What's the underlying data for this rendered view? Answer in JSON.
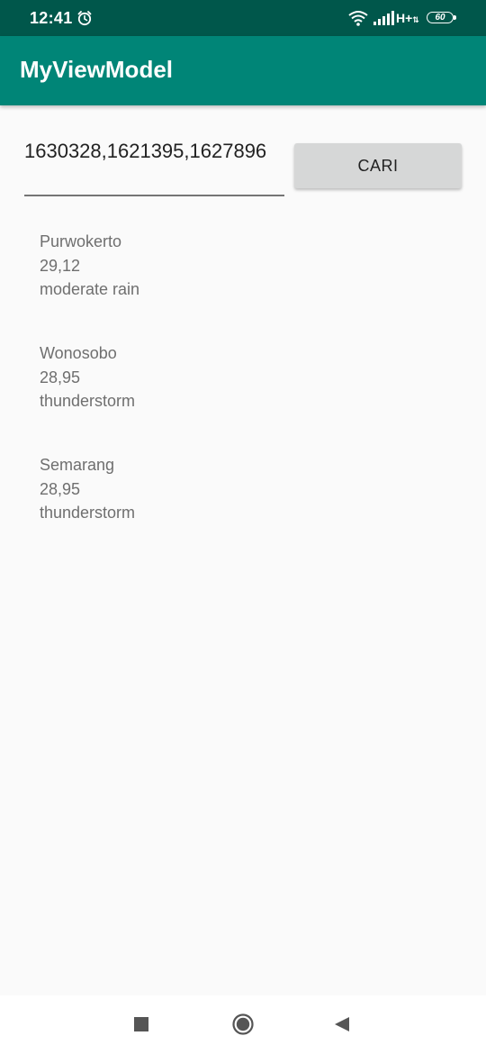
{
  "status_bar": {
    "time": "12:41",
    "network": "H+",
    "network_sub": "⇅",
    "battery": "60",
    "icons": [
      "alarm-icon",
      "wifi-icon",
      "signal-icon",
      "battery-icon"
    ]
  },
  "app_bar": {
    "title": "MyViewModel",
    "color": "#008577",
    "status_color": "#00574b"
  },
  "search": {
    "value": "1630328,1621395,1627896",
    "button_label": "CARI"
  },
  "weather": [
    {
      "city": "Purwokerto",
      "temp": "29,12",
      "desc": "moderate rain"
    },
    {
      "city": "Wonosobo",
      "temp": "28,95",
      "desc": "thunderstorm"
    },
    {
      "city": "Semarang",
      "temp": "28,95",
      "desc": "thunderstorm"
    }
  ],
  "nav_bar": {
    "icons": [
      "recents-icon",
      "home-icon",
      "back-icon"
    ]
  }
}
